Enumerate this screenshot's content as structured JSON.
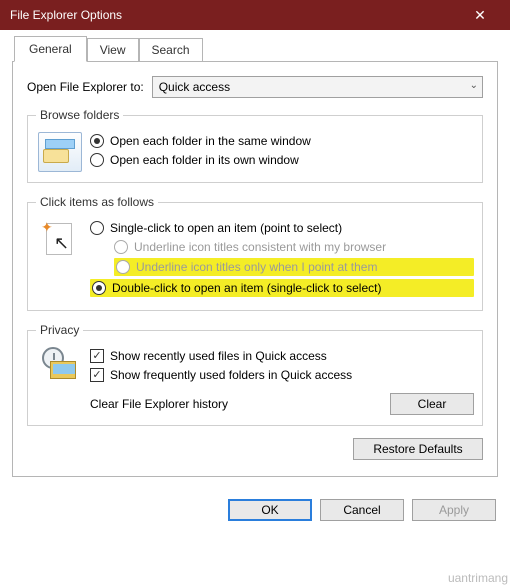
{
  "window": {
    "title": "File Explorer Options"
  },
  "tabs": {
    "general": "General",
    "view": "View",
    "search": "Search",
    "active": "general"
  },
  "open_to": {
    "label": "Open File Explorer to:",
    "value": "Quick access"
  },
  "browse": {
    "legend": "Browse folders",
    "same": "Open each folder in the same window",
    "own": "Open each folder in its own window",
    "selected": "same"
  },
  "click": {
    "legend": "Click items as follows",
    "single": "Single-click to open an item (point to select)",
    "underline_browser": "Underline icon titles consistent with my browser",
    "underline_point": "Underline icon titles only when I point at them",
    "double": "Double-click to open an item (single-click to select)",
    "selected": "double"
  },
  "privacy": {
    "legend": "Privacy",
    "recent_files": "Show recently used files in Quick access",
    "recent_files_checked": true,
    "frequent_folders": "Show frequently used folders in Quick access",
    "frequent_folders_checked": true,
    "clear_label": "Clear File Explorer history",
    "clear_button": "Clear"
  },
  "restore_defaults": "Restore Defaults",
  "buttons": {
    "ok": "OK",
    "cancel": "Cancel",
    "apply": "Apply"
  },
  "watermark": "uantrimang"
}
